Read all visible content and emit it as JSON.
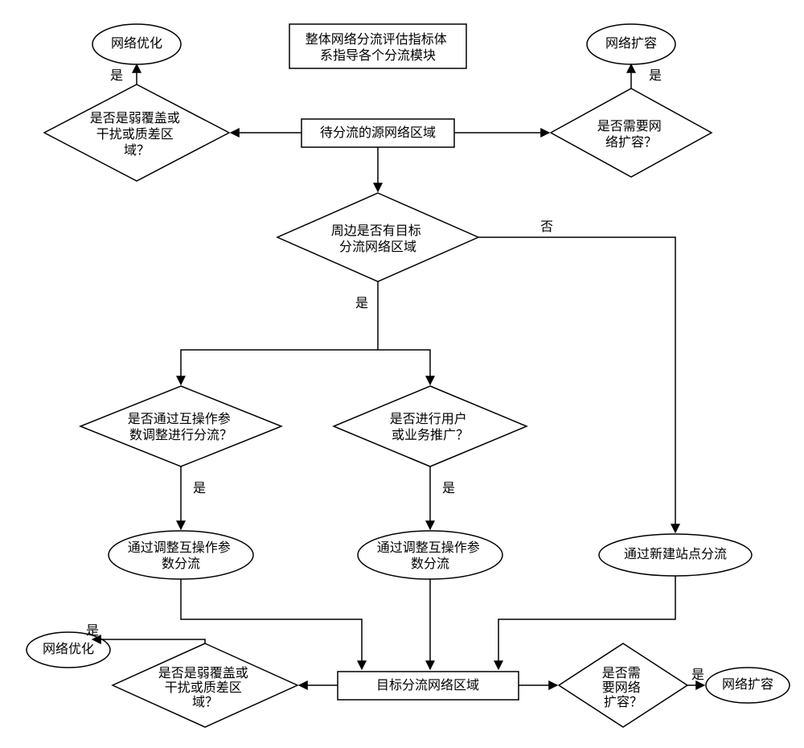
{
  "chart_data": {
    "type": "flowchart",
    "title_box": "整体网络分流评估指标体\n系指导各个分流模块",
    "nodes": {
      "opt_top": {
        "shape": "ellipse",
        "label": "网络优化"
      },
      "exp_top": {
        "shape": "ellipse",
        "label": "网络扩容"
      },
      "title": {
        "shape": "rect",
        "label": "整体网络分流评估指标体\n系指导各个分流模块"
      },
      "d_weak_top": {
        "shape": "diamond",
        "label": "是否是弱覆盖或\n干扰或质差区\n域？"
      },
      "source": {
        "shape": "rect",
        "label": "待分流的源网络区域"
      },
      "d_exp_top": {
        "shape": "diamond",
        "label": "是否需要网\n络扩容？"
      },
      "d_near": {
        "shape": "diamond",
        "label": "周边是否有目标\n分流网络区域"
      },
      "d_interop": {
        "shape": "diamond",
        "label": "是否通过互操作参\n数调整进行分流？"
      },
      "d_promo": {
        "shape": "diamond",
        "label": "是否进行用户\n或业务推广？"
      },
      "a_adjust1": {
        "shape": "ellipse",
        "label": "通过调整互操作参\n数分流"
      },
      "a_adjust2": {
        "shape": "ellipse",
        "label": "通过调整互操作参\n数分流"
      },
      "a_newsite": {
        "shape": "ellipse",
        "label": "通过新建站点分流"
      },
      "opt_bot": {
        "shape": "ellipse",
        "label": "网络优化"
      },
      "d_weak_bot": {
        "shape": "diamond",
        "label": "是否是弱覆盖或\n干扰或质差区\n域？"
      },
      "target": {
        "shape": "rect",
        "label": "目标分流网络区域"
      },
      "d_exp_bot": {
        "shape": "diamond",
        "label": "是否需\n要网络\n扩容？"
      },
      "exp_bot": {
        "shape": "ellipse",
        "label": "网络扩容"
      }
    },
    "edge_labels": {
      "yes": "是",
      "no": "否"
    },
    "edges": [
      {
        "from": "d_weak_top",
        "to": "opt_top",
        "label": "yes"
      },
      {
        "from": "source",
        "to": "d_weak_top"
      },
      {
        "from": "source",
        "to": "d_exp_top"
      },
      {
        "from": "d_exp_top",
        "to": "exp_top",
        "label": "yes"
      },
      {
        "from": "source",
        "to": "d_near"
      },
      {
        "from": "d_near",
        "to": "a_newsite",
        "label": "no"
      },
      {
        "from": "d_near",
        "to": "d_interop",
        "label": "yes"
      },
      {
        "from": "d_near",
        "to": "d_promo",
        "label": "yes"
      },
      {
        "from": "d_interop",
        "to": "a_adjust1",
        "label": "yes"
      },
      {
        "from": "d_promo",
        "to": "a_adjust2",
        "label": "yes"
      },
      {
        "from": "a_adjust1",
        "to": "target"
      },
      {
        "from": "a_adjust2",
        "to": "target"
      },
      {
        "from": "a_newsite",
        "to": "target"
      },
      {
        "from": "target",
        "to": "d_weak_bot"
      },
      {
        "from": "d_weak_bot",
        "to": "opt_bot",
        "label": "yes"
      },
      {
        "from": "target",
        "to": "d_exp_bot"
      },
      {
        "from": "d_exp_bot",
        "to": "exp_bot",
        "label": "yes"
      }
    ]
  }
}
